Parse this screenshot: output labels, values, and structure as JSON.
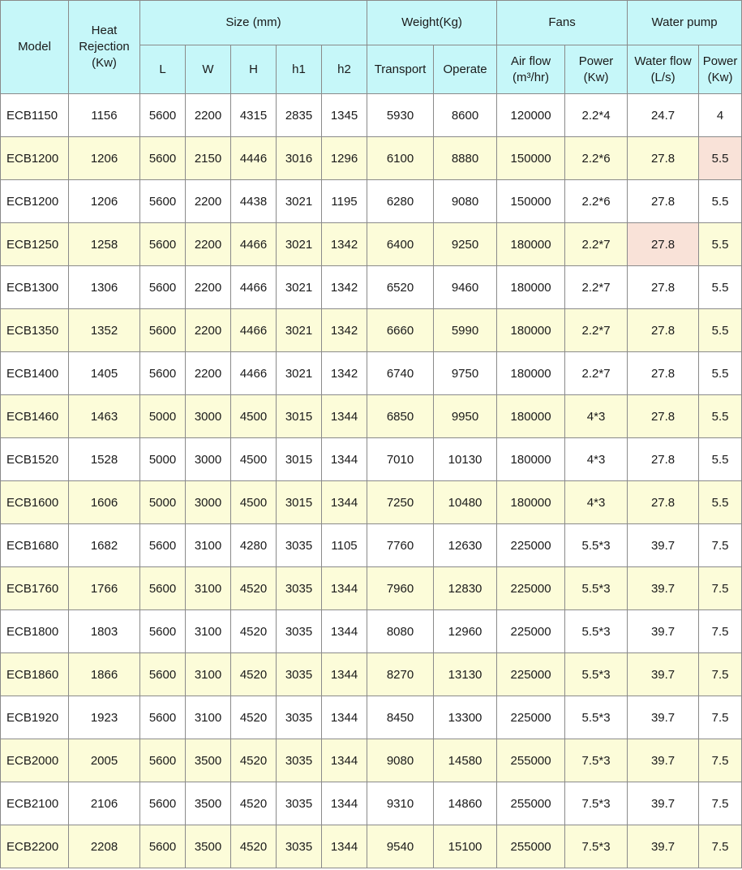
{
  "headers": {
    "model": "Model",
    "heat_rejection": [
      "Heat",
      "Rejection",
      "(Kw)"
    ],
    "size": "Size (mm)",
    "weight": "Weight(Kg)",
    "fans": "Fans",
    "water_pump": "Water pump",
    "L": "L",
    "W": "W",
    "H": "H",
    "h1": "h1",
    "h2": "h2",
    "transport": "Transport",
    "operate": "Operate",
    "air_flow": [
      "Air flow",
      "(m³/hr)"
    ],
    "fan_power": [
      "Power",
      "(Kw)"
    ],
    "water_flow": [
      "Water flow",
      "(L/s)"
    ],
    "pump_power": [
      "Power",
      "(Kw)"
    ]
  },
  "rows": [
    [
      "ECB1150",
      "1156",
      "5600",
      "2200",
      "4315",
      "2835",
      "1345",
      "5930",
      "8600",
      "120000",
      "2.2*4",
      "24.7",
      "4"
    ],
    [
      "ECB1200",
      "1206",
      "5600",
      "2150",
      "4446",
      "3016",
      "1296",
      "6100",
      "8880",
      "150000",
      "2.2*6",
      "27.8",
      "5.5"
    ],
    [
      "ECB1200",
      "1206",
      "5600",
      "2200",
      "4438",
      "3021",
      "1195",
      "6280",
      "9080",
      "150000",
      "2.2*6",
      "27.8",
      "5.5"
    ],
    [
      "ECB1250",
      "1258",
      "5600",
      "2200",
      "4466",
      "3021",
      "1342",
      "6400",
      "9250",
      "180000",
      "2.2*7",
      "27.8",
      "5.5"
    ],
    [
      "ECB1300",
      "1306",
      "5600",
      "2200",
      "4466",
      "3021",
      "1342",
      "6520",
      "9460",
      "180000",
      "2.2*7",
      "27.8",
      "5.5"
    ],
    [
      "ECB1350",
      "1352",
      "5600",
      "2200",
      "4466",
      "3021",
      "1342",
      "6660",
      "5990",
      "180000",
      "2.2*7",
      "27.8",
      "5.5"
    ],
    [
      "ECB1400",
      "1405",
      "5600",
      "2200",
      "4466",
      "3021",
      "1342",
      "6740",
      "9750",
      "180000",
      "2.2*7",
      "27.8",
      "5.5"
    ],
    [
      "ECB1460",
      "1463",
      "5000",
      "3000",
      "4500",
      "3015",
      "1344",
      "6850",
      "9950",
      "180000",
      "4*3",
      "27.8",
      "5.5"
    ],
    [
      "ECB1520",
      "1528",
      "5000",
      "3000",
      "4500",
      "3015",
      "1344",
      "7010",
      "10130",
      "180000",
      "4*3",
      "27.8",
      "5.5"
    ],
    [
      "ECB1600",
      "1606",
      "5000",
      "3000",
      "4500",
      "3015",
      "1344",
      "7250",
      "10480",
      "180000",
      "4*3",
      "27.8",
      "5.5"
    ],
    [
      "ECB1680",
      "1682",
      "5600",
      "3100",
      "4280",
      "3035",
      "1105",
      "7760",
      "12630",
      "225000",
      "5.5*3",
      "39.7",
      "7.5"
    ],
    [
      "ECB1760",
      "1766",
      "5600",
      "3100",
      "4520",
      "3035",
      "1344",
      "7960",
      "12830",
      "225000",
      "5.5*3",
      "39.7",
      "7.5"
    ],
    [
      "ECB1800",
      "1803",
      "5600",
      "3100",
      "4520",
      "3035",
      "1344",
      "8080",
      "12960",
      "225000",
      "5.5*3",
      "39.7",
      "7.5"
    ],
    [
      "ECB1860",
      "1866",
      "5600",
      "3100",
      "4520",
      "3035",
      "1344",
      "8270",
      "13130",
      "225000",
      "5.5*3",
      "39.7",
      "7.5"
    ],
    [
      "ECB1920",
      "1923",
      "5600",
      "3100",
      "4520",
      "3035",
      "1344",
      "8450",
      "13300",
      "225000",
      "5.5*3",
      "39.7",
      "7.5"
    ],
    [
      "ECB2000",
      "2005",
      "5600",
      "3500",
      "4520",
      "3035",
      "1344",
      "9080",
      "14580",
      "255000",
      "7.5*3",
      "39.7",
      "7.5"
    ],
    [
      "ECB2100",
      "2106",
      "5600",
      "3500",
      "4520",
      "3035",
      "1344",
      "9310",
      "14860",
      "255000",
      "7.5*3",
      "39.7",
      "7.5"
    ],
    [
      "ECB2200",
      "2208",
      "5600",
      "3500",
      "4520",
      "3035",
      "1344",
      "9540",
      "15100",
      "255000",
      "7.5*3",
      "39.7",
      "7.5"
    ]
  ],
  "highlighted_cells": [
    {
      "row": 1,
      "col": 12
    },
    {
      "row": 3,
      "col": 11
    }
  ],
  "colors": {
    "header_bg": "#c6f7f9",
    "row_odd_bg": "#ffffff",
    "row_even_bg": "#fcfcd9",
    "highlight_bg": "#f9e2d8",
    "border": "#8a8a8a"
  }
}
